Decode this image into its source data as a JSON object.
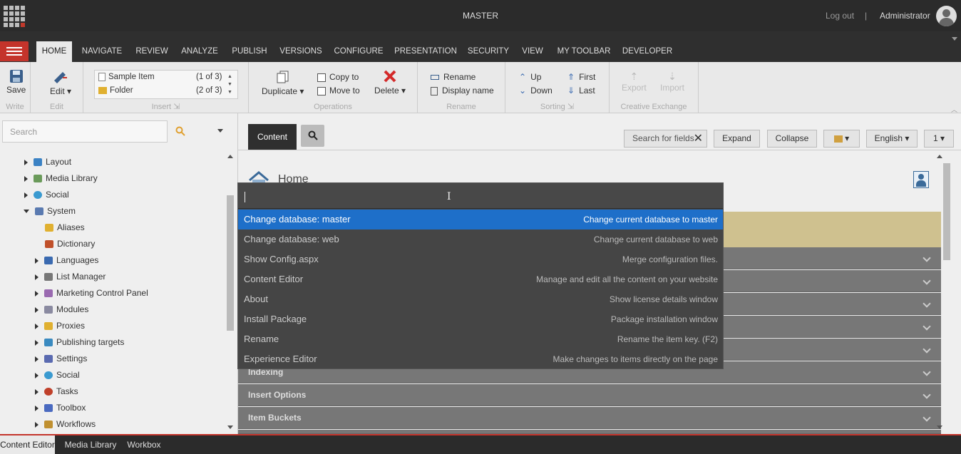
{
  "topbar": {
    "database": "MASTER",
    "logout": "Log out",
    "separator": "|",
    "user": "Administrator"
  },
  "ribbon_tabs": [
    "HOME",
    "NAVIGATE",
    "REVIEW",
    "ANALYZE",
    "PUBLISH",
    "VERSIONS",
    "CONFIGURE",
    "PRESENTATION",
    "SECURITY",
    "VIEW",
    "MY TOOLBAR",
    "DEVELOPER"
  ],
  "ribbon": {
    "write": {
      "save": "Save",
      "group": "Write"
    },
    "edit": {
      "edit": "Edit",
      "group": "Edit"
    },
    "insert": {
      "items": [
        {
          "label": "Sample Item",
          "count": "(1 of 3)"
        },
        {
          "label": "Folder",
          "count": "(2 of 3)"
        }
      ],
      "group": "Insert"
    },
    "operations": {
      "duplicate": "Duplicate",
      "copy_to": "Copy to",
      "move_to": "Move to",
      "delete": "Delete",
      "group": "Operations"
    },
    "rename": {
      "rename": "Rename",
      "display_name": "Display name",
      "group": "Rename"
    },
    "sorting": {
      "up": "Up",
      "down": "Down",
      "first": "First",
      "last": "Last",
      "group": "Sorting"
    },
    "exchange": {
      "export": "Export",
      "import": "Import",
      "group": "Creative Exchange"
    }
  },
  "left": {
    "search_placeholder": "Search",
    "tree": [
      {
        "label": "Layout",
        "color": "#3b82c4"
      },
      {
        "label": "Media Library",
        "color": "#6a9a5a"
      },
      {
        "label": "Social",
        "color": "#3a9ad0"
      },
      {
        "label": "System",
        "color": "#5a7ab0"
      },
      {
        "label": "Aliases",
        "color": "#e0b030"
      },
      {
        "label": "Dictionary",
        "color": "#c0502a"
      },
      {
        "label": "Languages",
        "color": "#3a6ab0"
      },
      {
        "label": "List Manager",
        "color": "#777777"
      },
      {
        "label": "Marketing Control Panel",
        "color": "#9a6ab0"
      },
      {
        "label": "Modules",
        "color": "#8a8aa0"
      },
      {
        "label": "Proxies",
        "color": "#e0b030"
      },
      {
        "label": "Publishing targets",
        "color": "#3a8ac0"
      },
      {
        "label": "Settings",
        "color": "#5a6ab0"
      },
      {
        "label": "Social",
        "color": "#3a9ad0"
      },
      {
        "label": "Tasks",
        "color": "#c0402a"
      },
      {
        "label": "Toolbox",
        "color": "#4a6ac0"
      },
      {
        "label": "Workflows",
        "color": "#c09030"
      }
    ]
  },
  "main": {
    "content_tab": "Content",
    "search_fields": "Search for fields",
    "expand": "Expand",
    "collapse": "Collapse",
    "language": "English",
    "version": "1",
    "home_title": "Home",
    "sections": [
      "Indexing",
      "Insert Options",
      "Item Buckets"
    ]
  },
  "palette": {
    "input_value": "",
    "items": [
      {
        "name": "Change database: master",
        "desc": "Change current database to master"
      },
      {
        "name": "Change database: web",
        "desc": "Change current database to web"
      },
      {
        "name": "Show Config.aspx",
        "desc": "Merge configuration files."
      },
      {
        "name": "Content Editor",
        "desc": "Manage and edit all the content on your website"
      },
      {
        "name": "About",
        "desc": "Show license details window"
      },
      {
        "name": "Install Package",
        "desc": "Package installation window"
      },
      {
        "name": "Rename",
        "desc": "Rename the item key. (F2)"
      },
      {
        "name": "Experience Editor",
        "desc": "Make changes to items directly on the page"
      }
    ]
  },
  "bottom_tabs": [
    "Content Editor",
    "Media Library",
    "Workbox"
  ]
}
